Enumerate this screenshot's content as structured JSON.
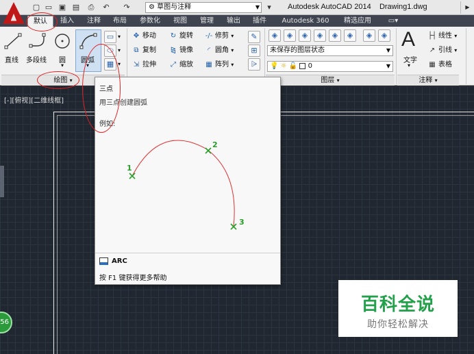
{
  "titlebar": {
    "workspace": "草图与注释",
    "app_name": "Autodesk AutoCAD 2014",
    "document": "Drawing1.dwg"
  },
  "tabs": [
    "默认",
    "插入",
    "注释",
    "布局",
    "参数化",
    "视图",
    "管理",
    "输出",
    "插件",
    "Autodesk 360",
    "精选应用"
  ],
  "active_tab": "默认",
  "draw_panel": {
    "title": "绘图",
    "tools": [
      {
        "label": "直线"
      },
      {
        "label": "多段线"
      },
      {
        "label": "圆"
      },
      {
        "label": "圆弧"
      }
    ]
  },
  "modify_panel": {
    "tools": [
      {
        "label": "移动"
      },
      {
        "label": "旋转"
      },
      {
        "label": "修剪"
      },
      {
        "label": "复制"
      },
      {
        "label": "镜像"
      },
      {
        "label": "圆角"
      },
      {
        "label": "拉伸"
      },
      {
        "label": "缩放"
      },
      {
        "label": "阵列"
      }
    ]
  },
  "layers_panel": {
    "title": "图层",
    "layer_state": "未保存的图层状态",
    "current_layer": "0"
  },
  "annotation_panel": {
    "title": "注释",
    "text_label": "文字",
    "tools": [
      {
        "label": "线性"
      },
      {
        "label": "引线"
      },
      {
        "label": "表格"
      }
    ]
  },
  "viewport": {
    "label": "[-][俯视][二维线框]"
  },
  "tooltip": {
    "title": "三点",
    "description": "用三点创建圆弧",
    "example_label": "例如:",
    "points": [
      "1",
      "2",
      "3"
    ],
    "command": "ARC",
    "help": "按 F1 键获得更多帮助"
  },
  "status_badge": "56",
  "watermark": {
    "title": "百科全说",
    "subtitle": "助你轻松解决"
  },
  "colors": {
    "arc_curve": "#e03030",
    "point_marker": "#28a028",
    "annotation_circle": "#e02020",
    "tab_bar": "#3f4450",
    "drawing_bg": "#212730"
  }
}
